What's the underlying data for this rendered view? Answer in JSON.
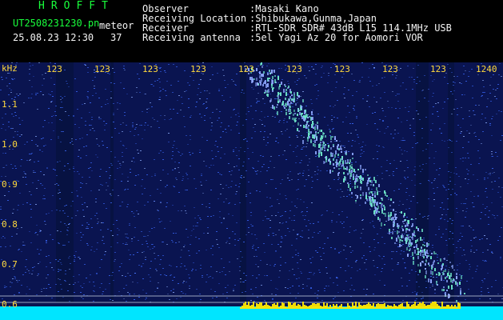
{
  "header": {
    "title": "HROFFT",
    "filename": "UT2508231230.pn",
    "label": "meteor",
    "datetime": "25.08.23 12:30",
    "value": "37",
    "info": [
      {
        "label": "Observer",
        "value": ":Masaki Kano"
      },
      {
        "label": "Receiving Location",
        "value": ":Shibukawa,Gunma,Japan"
      },
      {
        "label": "Receiver",
        "value": ":RTL-SDR SDR# 43dB L15 114.1MHz USB"
      },
      {
        "label": "Receiving antenna",
        "value": ":5el Yagi Az 20 for Aomori VOR"
      }
    ]
  },
  "spectrogram": {
    "y_unit": "kHz",
    "x_ticks": [
      "123",
      "123",
      "123",
      "123",
      "123",
      "123",
      "123",
      "123",
      "123",
      "1240"
    ],
    "y_ticks": [
      "1.1",
      "1.0",
      "0.9",
      "0.8",
      "0.7",
      "0.6"
    ],
    "colors": {
      "background": "#0a1450",
      "noise": "#3c6bff",
      "signal": "#6ee6c8",
      "baseline": "#00e5ff",
      "ticks": "#ffd93c",
      "header_text": "#f4f4f4",
      "title": "#19ff3c"
    }
  }
}
